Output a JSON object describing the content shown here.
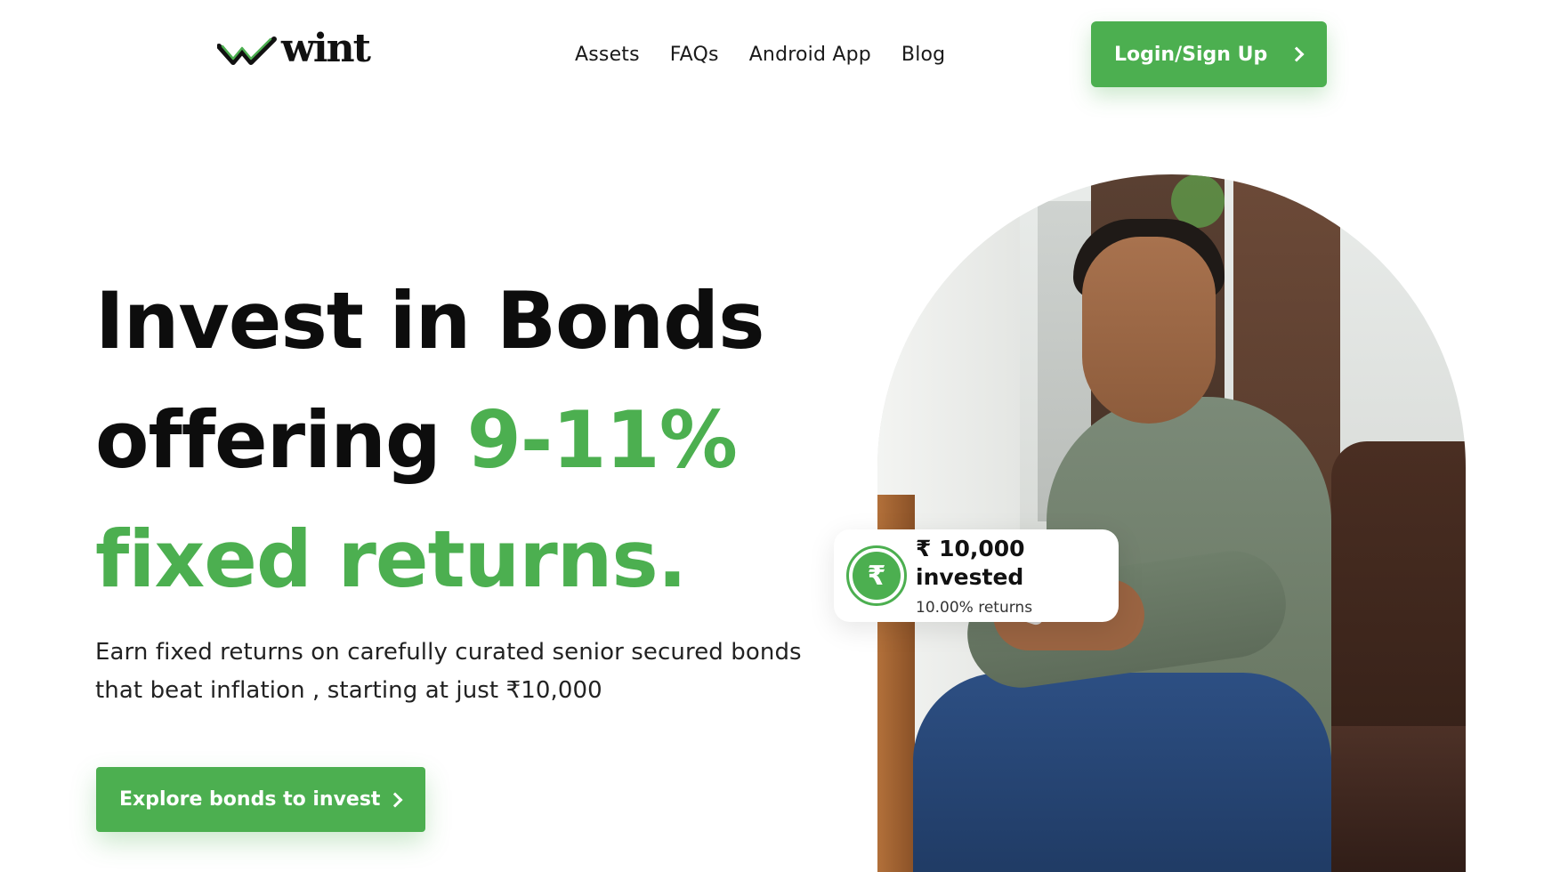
{
  "header": {
    "logo_text": "wint",
    "nav": [
      "Assets",
      "FAQs",
      "Android App",
      "Blog"
    ],
    "login_label": "Login/Sign Up"
  },
  "hero": {
    "title_line1": "Invest in Bonds",
    "title_line2_prefix": "offering ",
    "title_line2_highlight": "9-11%",
    "title_line3": "fixed returns.",
    "subtitle_line1": "Earn fixed returns on carefully curated senior secured bonds",
    "subtitle_line2": "that beat inflation , starting at just ₹10,000",
    "cta_label": "Explore bonds to invest"
  },
  "invest_card": {
    "currency_symbol": "₹",
    "amount": "₹ 10,000 invested",
    "returns": "10.00% returns"
  },
  "colors": {
    "brand_green": "#4caf50",
    "text_dark": "#0d0d0d"
  },
  "icons": [
    "wint-logo-icon",
    "chevron-right-icon",
    "rupee-coin-icon"
  ]
}
